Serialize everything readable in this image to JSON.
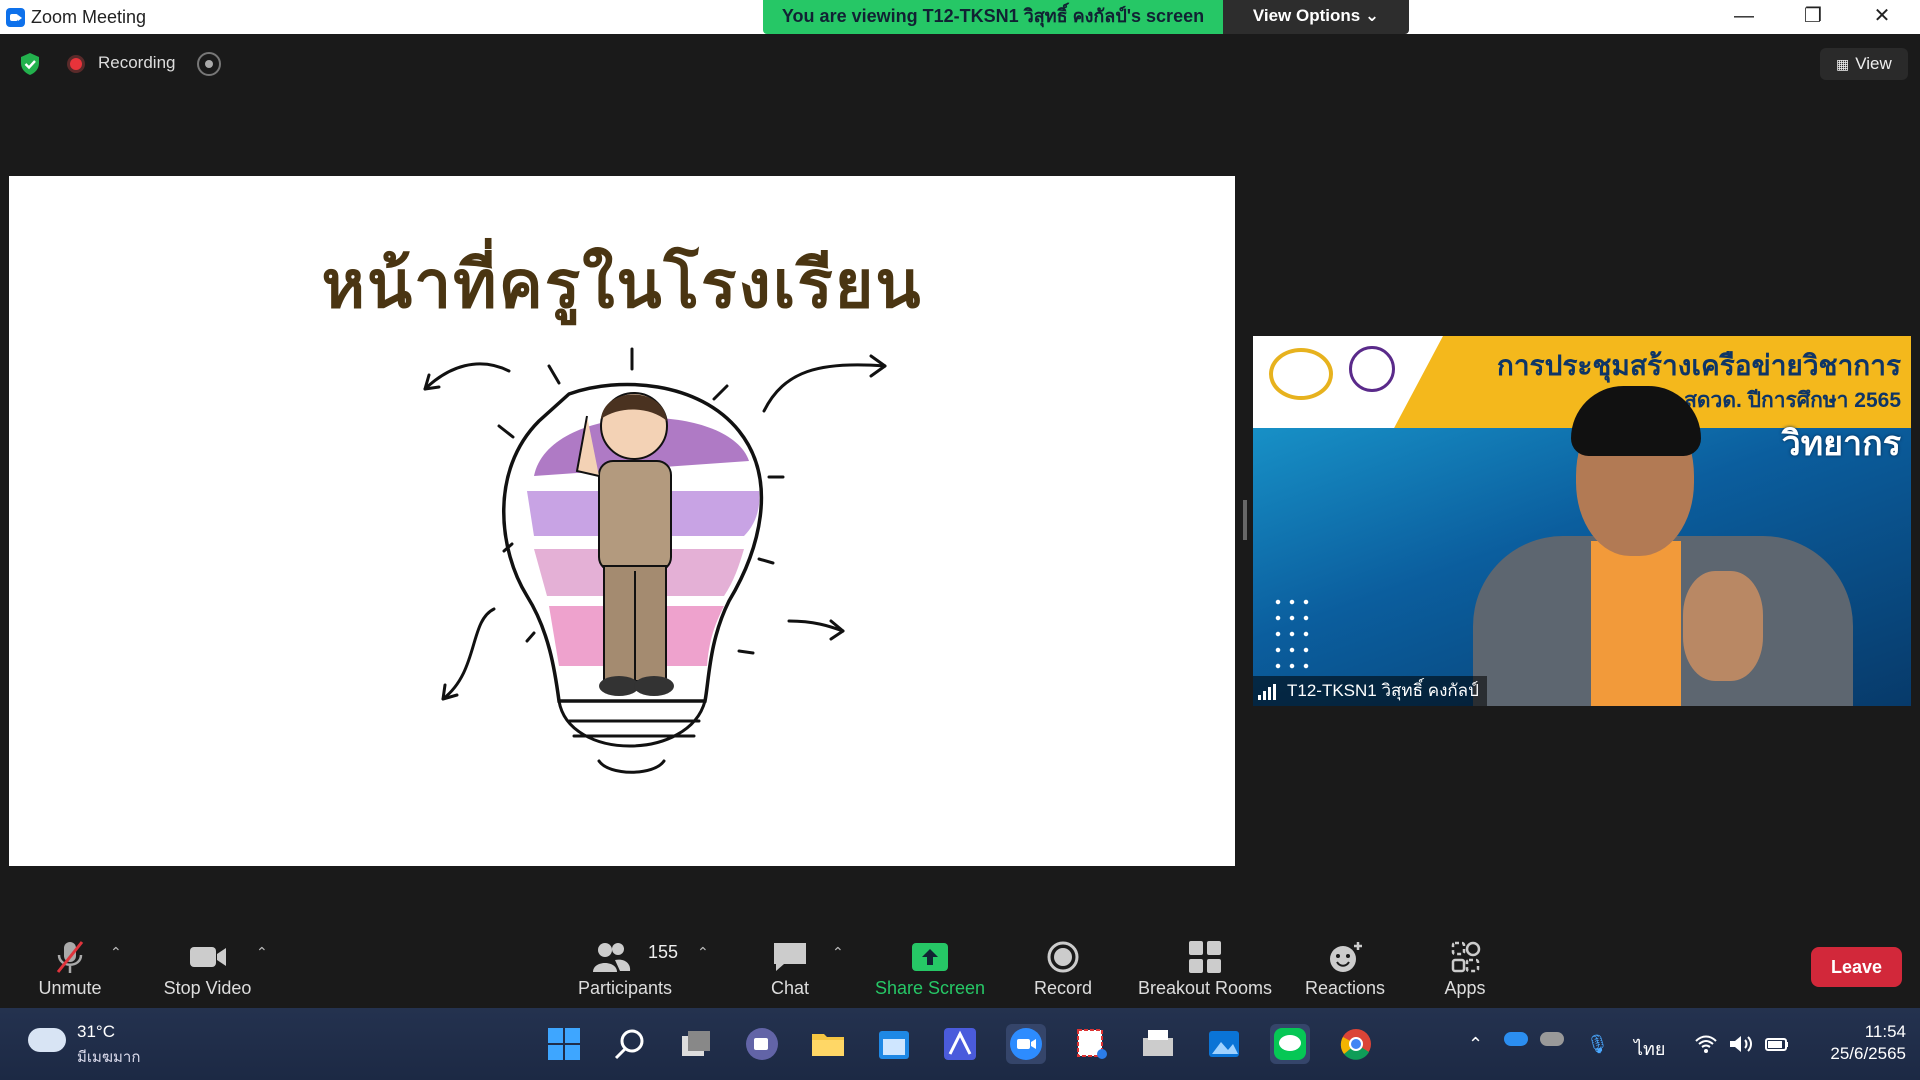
{
  "window": {
    "title": "Zoom Meeting"
  },
  "banner": {
    "viewing": "You are viewing T12-TKSN1 วิสุทธิ์ คงกัลป์'s screen",
    "view_options": "View Options ⌄"
  },
  "window_controls": {
    "minimize": "—",
    "maximize": "❐",
    "close": "✕"
  },
  "meeting": {
    "recording_label": "Recording",
    "view_label": "View"
  },
  "slide": {
    "title": "หน้าที่ครูในโรงเรียน"
  },
  "video": {
    "header_line1": "การประชุมสร้างเครือข่ายวิชาการ",
    "header_line2": "สดวด. ปีการศึกษา 2565",
    "header_line3": "วิทยากร",
    "participant_name": "T12-TKSN1 วิสุทธิ์ คงกัลป์"
  },
  "toolbar": {
    "unmute": "Unmute",
    "stop_video": "Stop Video",
    "participants": "Participants",
    "participants_count": "155",
    "chat": "Chat",
    "share_screen": "Share Screen",
    "record": "Record",
    "breakout_rooms": "Breakout Rooms",
    "reactions": "Reactions",
    "apps": "Apps",
    "leave": "Leave"
  },
  "taskbar": {
    "weather_temp": "31°C",
    "weather_desc": "มีเมฆมาก",
    "language": "ไทย",
    "time": "11:54",
    "date": "25/6/2565"
  },
  "colors": {
    "accent_green": "#26c766",
    "leave_red": "#d2283a",
    "zoom_blue": "#0e71eb"
  }
}
